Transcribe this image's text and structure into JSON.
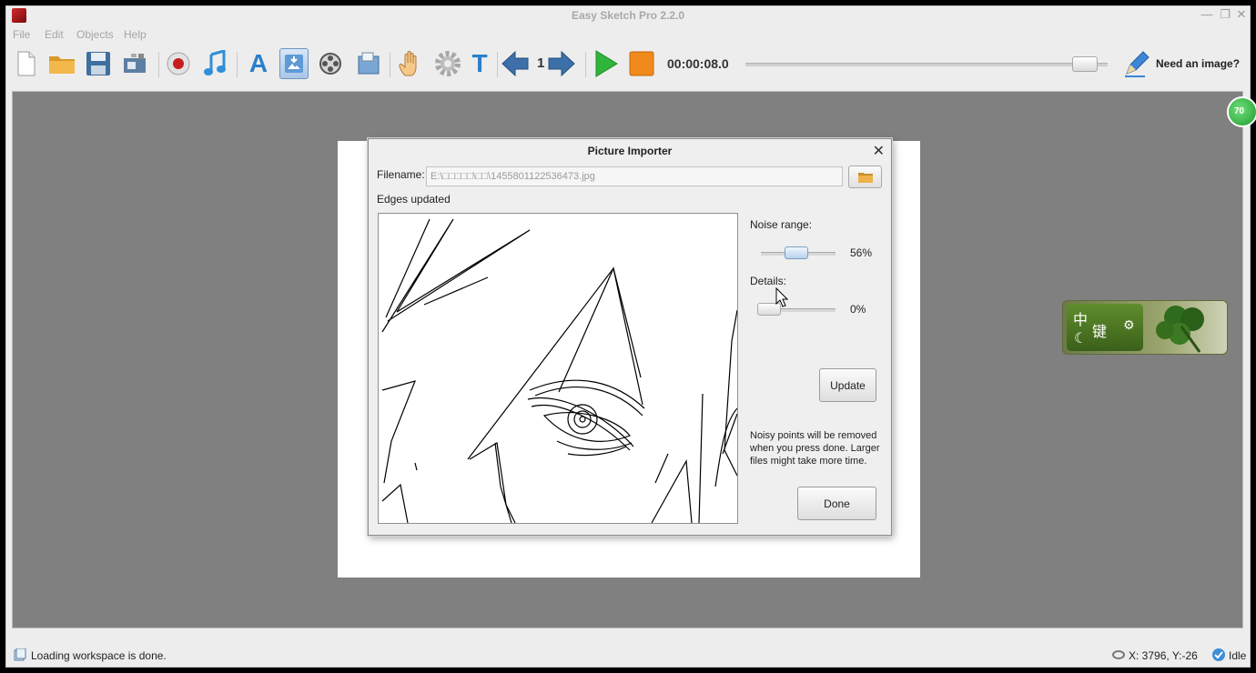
{
  "app": {
    "title": "Easy Sketch Pro 2.2.0"
  },
  "window_controls": {
    "minimize": "—",
    "restore": "❐",
    "close": "✕"
  },
  "menu": [
    "File",
    "Edit",
    "Objects",
    "Help"
  ],
  "toolbar": {
    "slide_number": "1",
    "timecode": "00:00:08.0",
    "need_image_label": "Need an image?",
    "text_tool_label": "T",
    "text_art_label": "A",
    "timeline_position": 0.95,
    "active_tool": "picture-importer"
  },
  "dialog": {
    "title": "Picture Importer",
    "close_label": "✕",
    "filename_label": "Filename:",
    "filename_value": "E:\\□□□□□\\□□\\1455801122536473.jpg",
    "status": "Edges updated",
    "noise_label": "Noise range:",
    "noise_value": "56%",
    "noise_level": 0.56,
    "details_label": "Details:",
    "details_value": "0%",
    "details_level": 0.0,
    "update_button": "Update",
    "hint": "Noisy points will be removed when you press done. Larger files might take more time.",
    "done_button": "Done"
  },
  "ime": {
    "mode_char": "中",
    "key_char": "键",
    "moon": "☾",
    "gear": "⚙"
  },
  "badge": {
    "text": "70"
  },
  "statusbar": {
    "message": "Loading workspace is done.",
    "coordinates": "X: 3796, Y:-26",
    "state": "Idle"
  },
  "colors": {
    "accent": "#6f95c1",
    "play": "#2fb43c",
    "stop": "#f08a1c",
    "arrows": "#3d6fa8"
  }
}
